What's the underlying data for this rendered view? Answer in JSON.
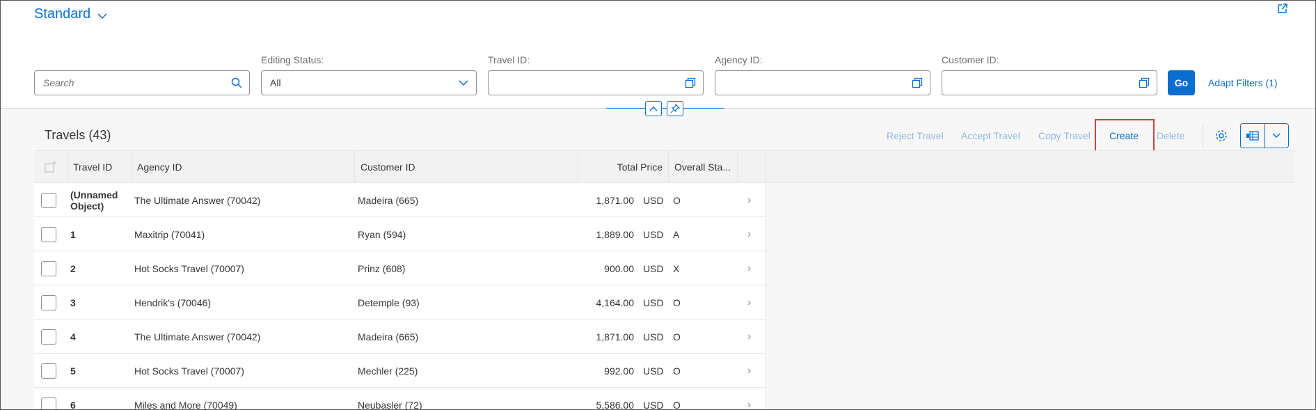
{
  "variant": {
    "label": "Standard"
  },
  "filters": {
    "search_placeholder": "Search",
    "editing_status": {
      "label": "Editing Status:",
      "value": "All"
    },
    "travel_id": {
      "label": "Travel ID:",
      "value": ""
    },
    "agency_id": {
      "label": "Agency ID:",
      "value": ""
    },
    "customer_id": {
      "label": "Customer ID:",
      "value": ""
    },
    "go_label": "Go",
    "adapt_label": "Adapt Filters (1)"
  },
  "table": {
    "title": "Travels (43)",
    "actions": {
      "reject": "Reject Travel",
      "accept": "Accept Travel",
      "copy": "Copy Travel",
      "create": "Create",
      "delete": "Delete"
    },
    "columns": [
      "Travel ID",
      "Agency ID",
      "Customer ID",
      "Total Price",
      "Overall Sta..."
    ],
    "rows": [
      {
        "travel_id": "(Unnamed Object)",
        "agency": "The Ultimate Answer (70042)",
        "customer": "Madeira (665)",
        "price": "1,871.00",
        "currency": "USD",
        "status": "O"
      },
      {
        "travel_id": "1",
        "agency": "Maxitrip (70041)",
        "customer": "Ryan (594)",
        "price": "1,889.00",
        "currency": "USD",
        "status": "A"
      },
      {
        "travel_id": "2",
        "agency": "Hot Socks Travel (70007)",
        "customer": "Prinz (608)",
        "price": "900.00",
        "currency": "USD",
        "status": "X"
      },
      {
        "travel_id": "3",
        "agency": "Hendrik's (70046)",
        "customer": "Detemple (93)",
        "price": "4,164.00",
        "currency": "USD",
        "status": "O"
      },
      {
        "travel_id": "4",
        "agency": "The Ultimate Answer (70042)",
        "customer": "Madeira (665)",
        "price": "1,871.00",
        "currency": "USD",
        "status": "O"
      },
      {
        "travel_id": "5",
        "agency": "Hot Socks Travel (70007)",
        "customer": "Mechler (225)",
        "price": "992.00",
        "currency": "USD",
        "status": "O"
      },
      {
        "travel_id": "6",
        "agency": "Miles and More (70049)",
        "customer": "Neubasler (72)",
        "price": "5,586.00",
        "currency": "USD",
        "status": "O"
      }
    ]
  },
  "colors": {
    "accent": "#0a6ed1",
    "highlight": "#e03b3b",
    "disabled": "#95b8dc"
  },
  "icons": [
    "chevron-down-icon",
    "share-icon",
    "search-icon",
    "value-help-icon",
    "collapse-icon",
    "pin-icon",
    "settings-icon",
    "export-icon",
    "row-nav-icon"
  ]
}
